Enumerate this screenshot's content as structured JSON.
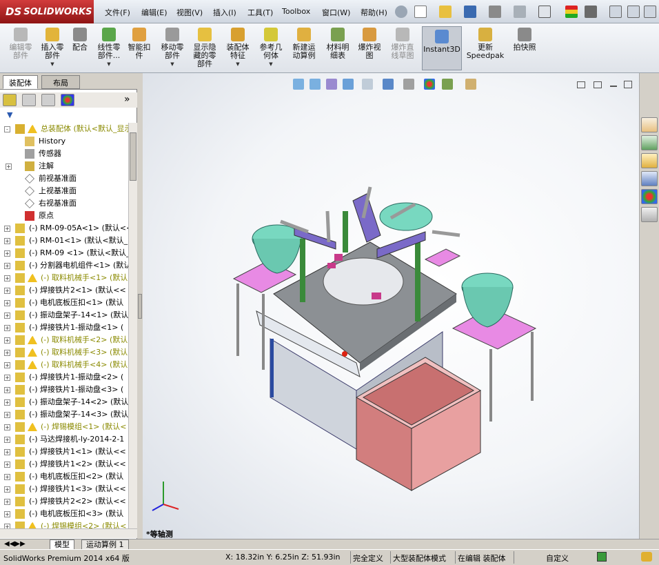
{
  "app": {
    "logo_ds": "DS",
    "logo_text": "SOLIDWORKS"
  },
  "menu": [
    "文件(F)",
    "编辑(E)",
    "视图(V)",
    "插入(I)",
    "工具(T)",
    "Toolbox",
    "窗口(W)",
    "帮助(H)"
  ],
  "commands": [
    {
      "label": "编辑零\n部件",
      "disabled": true,
      "arrow": false,
      "color": "#b8b8b8"
    },
    {
      "label": "插入零\n部件",
      "disabled": false,
      "arrow": true,
      "color": "#e2b43a"
    },
    {
      "label": "配合",
      "disabled": false,
      "arrow": false,
      "color": "#8a8a8a"
    },
    {
      "label": "线性零\n部件...",
      "disabled": false,
      "arrow": true,
      "color": "#5aa64a"
    },
    {
      "label": "智能扣\n件",
      "disabled": false,
      "arrow": false,
      "color": "#e0a040"
    },
    {
      "label": "移动零\n部件",
      "disabled": false,
      "arrow": true,
      "color": "#9a9a9a"
    },
    {
      "label": "显示隐\n藏的零\n部件",
      "disabled": false,
      "arrow": false,
      "color": "#e6c040"
    },
    {
      "label": "装配体\n特征",
      "disabled": false,
      "arrow": true,
      "color": "#d8a030"
    },
    {
      "label": "参考几\n何体",
      "disabled": false,
      "arrow": true,
      "color": "#d4c838"
    },
    {
      "label": "新建运\n动算例",
      "disabled": false,
      "arrow": false,
      "color": "#e0b040"
    },
    {
      "label": "材料明\n细表",
      "disabled": false,
      "arrow": false,
      "color": "#7aa050"
    },
    {
      "label": "爆炸视\n图",
      "disabled": false,
      "arrow": false,
      "color": "#d89a40"
    },
    {
      "label": "爆炸直\n线草图",
      "disabled": true,
      "arrow": false,
      "color": "#b8b8b8"
    },
    {
      "label": "Instant3D",
      "disabled": false,
      "arrow": false,
      "active": true,
      "color": "#5a8ad0"
    },
    {
      "label": "更新\nSpeedpak",
      "disabled": false,
      "arrow": false,
      "color": "#d8b040"
    },
    {
      "label": "拍快照",
      "disabled": false,
      "arrow": false,
      "color": "#8a8a8a"
    }
  ],
  "panel": {
    "tabs": [
      "装配体",
      "布局"
    ]
  },
  "tree": [
    {
      "label": "总装配体 (默认<默认_显示",
      "type": "asm",
      "warn": true,
      "expand": "-"
    },
    {
      "label": "History",
      "type": "history",
      "indent": 1
    },
    {
      "label": "传感器",
      "type": "sensor",
      "indent": 1
    },
    {
      "label": "注解",
      "type": "anno",
      "indent": 1,
      "expand": "+"
    },
    {
      "label": "前视基准面",
      "type": "plane",
      "indent": 1
    },
    {
      "label": "上视基准面",
      "type": "plane",
      "indent": 1
    },
    {
      "label": "右视基准面",
      "type": "plane",
      "indent": 1
    },
    {
      "label": "原点",
      "type": "origin",
      "indent": 1
    },
    {
      "label": "(-) RM-09-05A<1> (默认<<",
      "type": "part",
      "expand": "+"
    },
    {
      "label": "(-) RM-01<1> (默认<默认_",
      "type": "part",
      "expand": "+"
    },
    {
      "label": "(-) RM-09 <1> (默认<默认_",
      "type": "part",
      "expand": "+"
    },
    {
      "label": "(-) 分割器电机组件<1> (默认",
      "type": "part",
      "expand": "+"
    },
    {
      "label": "(-) 取料机械手<1> (默认",
      "type": "part",
      "warn": true,
      "expand": "+"
    },
    {
      "label": "(-) 焊接铁片2<1> (默认<<",
      "type": "part",
      "expand": "+"
    },
    {
      "label": "(-) 电机底板压扣<1> (默认",
      "type": "part",
      "expand": "+"
    },
    {
      "label": "(-) 振动盘架子-14<1> (默认",
      "type": "part",
      "expand": "+"
    },
    {
      "label": "(-) 焊接铁片1-振动盘<1> (",
      "type": "part",
      "expand": "+"
    },
    {
      "label": "(-) 取料机械手<2> (默认",
      "type": "part",
      "warn": true,
      "expand": "+"
    },
    {
      "label": "(-) 取料机械手<3> (默认",
      "type": "part",
      "warn": true,
      "expand": "+"
    },
    {
      "label": "(-) 取料机械手<4> (默认",
      "type": "part",
      "warn": true,
      "expand": "+"
    },
    {
      "label": "(-) 焊接铁片1-振动盘<2> (",
      "type": "part",
      "expand": "+"
    },
    {
      "label": "(-) 焊接铁片1-振动盘<3> (",
      "type": "part",
      "expand": "+"
    },
    {
      "label": "(-) 振动盘架子-14<2> (默认",
      "type": "part",
      "expand": "+"
    },
    {
      "label": "(-) 振动盘架子-14<3> (默认",
      "type": "part",
      "expand": "+"
    },
    {
      "label": "(-) 焊锡模组<1> (默认<",
      "type": "part",
      "warn": true,
      "expand": "+"
    },
    {
      "label": "(-) 马达焊接机-ly-2014-2-1",
      "type": "part",
      "expand": "+"
    },
    {
      "label": "(-) 焊接铁片1<1> (默认<<",
      "type": "part",
      "expand": "+"
    },
    {
      "label": "(-) 焊接铁片1<2> (默认<<",
      "type": "part",
      "expand": "+"
    },
    {
      "label": "(-) 电机底板压扣<2> (默认",
      "type": "part",
      "expand": "+"
    },
    {
      "label": "(-) 焊接铁片1<3> (默认<<",
      "type": "part",
      "expand": "+"
    },
    {
      "label": "(-) 焊接铁片2<2> (默认<<",
      "type": "part",
      "expand": "+"
    },
    {
      "label": "(-) 电机底板压扣<3> (默认",
      "type": "part",
      "expand": "+"
    },
    {
      "label": "(-) 焊锡模组<2> (默认<",
      "type": "part",
      "warn": true,
      "expand": "+"
    }
  ],
  "viewport": {
    "view_name": "*等轴测"
  },
  "bottom_tabs": [
    "模型",
    "运动算例 1"
  ],
  "status": {
    "product": "SolidWorks Premium 2014 x64 版",
    "coords": "X: 18.32in Y: 6.25in Z: 51.93in",
    "state": "完全定义",
    "mode": "大型装配体模式",
    "editing": "在编辑 装配体",
    "units": "自定义"
  },
  "colors": {
    "accent_red": "#b22222",
    "pink": "#e86fe0",
    "teal": "#60c8b0",
    "box": "#d88585"
  }
}
